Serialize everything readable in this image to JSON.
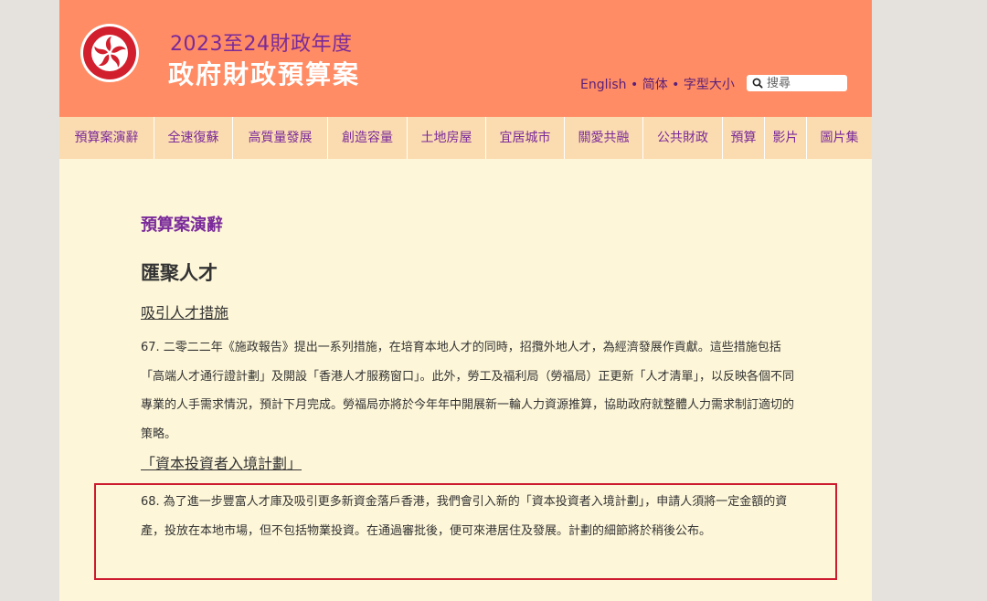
{
  "header": {
    "title_line1": "2023至24財政年度",
    "title_line2": "政府財政預算案",
    "lang_english": "English",
    "sep1": " • ",
    "lang_simplified": "简体",
    "sep2": " • ",
    "font_size": "字型大小",
    "search_placeholder": "搜尋"
  },
  "nav": {
    "items": [
      {
        "label": "預算案演辭"
      },
      {
        "label": "全速復蘇"
      },
      {
        "label": "高質量發展"
      },
      {
        "label": "創造容量"
      },
      {
        "label": "土地房屋"
      },
      {
        "label": "宜居城市"
      },
      {
        "label": "關愛共融"
      },
      {
        "label": "公共財政"
      },
      {
        "label": "預算"
      },
      {
        "label": "影片"
      },
      {
        "label": "圖片集"
      }
    ]
  },
  "content": {
    "section_title": "預算案演辭",
    "heading": "匯聚人才",
    "subheading1": "吸引人才措施",
    "para67": "67. 二零二二年《施政報告》提出一系列措施，在培育本地人才的同時，招攬外地人才，為經濟發展作貢獻。這些措施包括「高端人才通行證計劃」及開設「香港人才服務窗口」。此外，勞工及福利局（勞福局）正更新「人才清單」，以反映各個不同專業的人手需求情況，預計下月完成。勞福局亦將於今年年中開展新一輪人力資源推算，協助政府就整體人力需求制訂適切的策略。",
    "subheading2": "「資本投資者入境計劃」",
    "para68": "68. 為了進一步豐富人才庫及吸引更多新資金落戶香港，我們會引入新的「資本投資者入境計劃」，申請人須將一定金額的資產，投放在本地市場，但不包括物業投資。在通過審批後，便可來港居住及發展。計劃的細節將於稍後公布。"
  },
  "colors": {
    "header_bg": "#ff8c64",
    "nav_bg": "#fbdcb0",
    "page_bg": "#fdf6d8",
    "accent_purple": "#7a2a9a",
    "highlight_border": "#cc1b2e"
  },
  "icons": {
    "emblem": "hong-kong-emblem-icon",
    "search": "search-icon"
  }
}
